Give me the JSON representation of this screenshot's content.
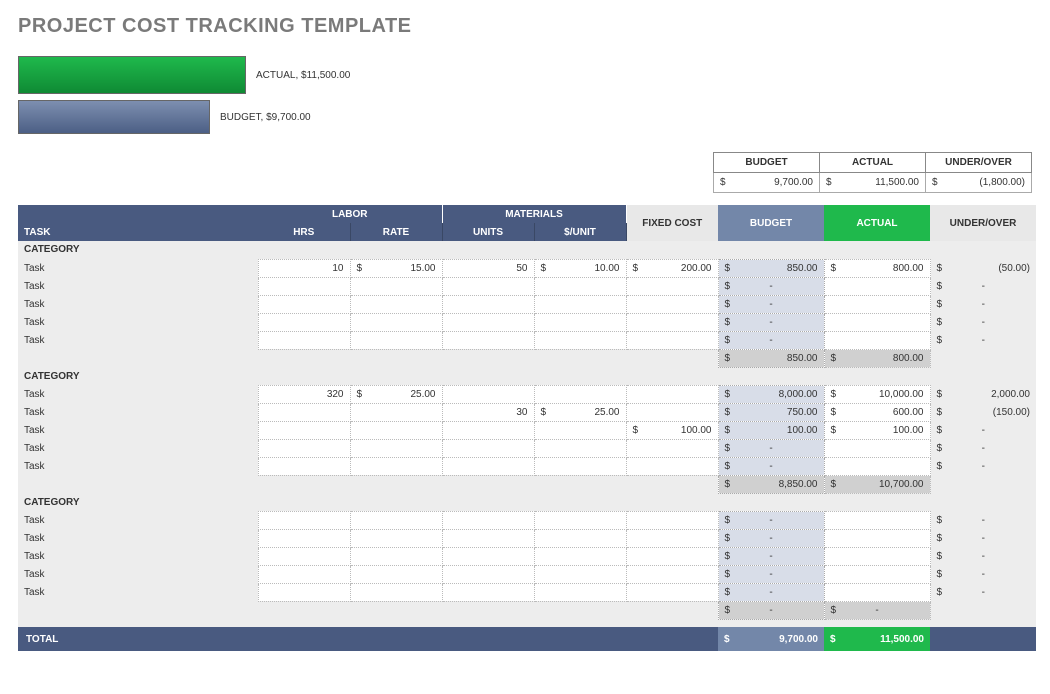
{
  "title": "PROJECT COST TRACKING TEMPLATE",
  "chart_data": {
    "type": "bar",
    "orientation": "horizontal",
    "series": [
      {
        "name": "ACTUAL",
        "value": 11500.0,
        "label": "ACTUAL,  $11,500.00",
        "color": "#1fb94c"
      },
      {
        "name": "BUDGET",
        "value": 9700.0,
        "label": "BUDGET,  $9,700.00",
        "color": "#5a6d93"
      }
    ]
  },
  "summary": {
    "headers": {
      "budget": "BUDGET",
      "actual": "ACTUAL",
      "underover": "UNDER/OVER"
    },
    "budget": "9,700.00",
    "actual": "11,500.00",
    "underover": "(1,800.00)"
  },
  "columns": {
    "task": "TASK",
    "labor": "LABOR",
    "materials": "MATERIALS",
    "fixed": "FIXED COST",
    "budget": "BUDGET",
    "actual": "ACTUAL",
    "underover": "UNDER/OVER",
    "hrs": "HRS",
    "rate": "RATE",
    "units": "UNITS",
    "per_unit": "$/UNIT"
  },
  "categories": [
    {
      "name": "CATEGORY",
      "tasks": [
        {
          "name": "Task",
          "hrs": "10",
          "rate": "15.00",
          "units": "50",
          "per_unit": "10.00",
          "fixed": "200.00",
          "budget": "850.00",
          "actual": "800.00",
          "uo": "(50.00)"
        },
        {
          "name": "Task",
          "hrs": "",
          "rate": "",
          "units": "",
          "per_unit": "",
          "fixed": "",
          "budget": "-",
          "actual": "",
          "uo": "-"
        },
        {
          "name": "Task",
          "hrs": "",
          "rate": "",
          "units": "",
          "per_unit": "",
          "fixed": "",
          "budget": "-",
          "actual": "",
          "uo": "-"
        },
        {
          "name": "Task",
          "hrs": "",
          "rate": "",
          "units": "",
          "per_unit": "",
          "fixed": "",
          "budget": "-",
          "actual": "",
          "uo": "-"
        },
        {
          "name": "Task",
          "hrs": "",
          "rate": "",
          "units": "",
          "per_unit": "",
          "fixed": "",
          "budget": "-",
          "actual": "",
          "uo": "-"
        }
      ],
      "subtotal": {
        "budget": "850.00",
        "actual": "800.00"
      }
    },
    {
      "name": "CATEGORY",
      "tasks": [
        {
          "name": "Task",
          "hrs": "320",
          "rate": "25.00",
          "units": "",
          "per_unit": "",
          "fixed": "",
          "budget": "8,000.00",
          "actual": "10,000.00",
          "uo": "2,000.00"
        },
        {
          "name": "Task",
          "hrs": "",
          "rate": "",
          "units": "30",
          "per_unit": "25.00",
          "fixed": "",
          "budget": "750.00",
          "actual": "600.00",
          "uo": "(150.00)"
        },
        {
          "name": "Task",
          "hrs": "",
          "rate": "",
          "units": "",
          "per_unit": "",
          "fixed": "100.00",
          "budget": "100.00",
          "actual": "100.00",
          "uo": "-"
        },
        {
          "name": "Task",
          "hrs": "",
          "rate": "",
          "units": "",
          "per_unit": "",
          "fixed": "",
          "budget": "-",
          "actual": "",
          "uo": "-"
        },
        {
          "name": "Task",
          "hrs": "",
          "rate": "",
          "units": "",
          "per_unit": "",
          "fixed": "",
          "budget": "-",
          "actual": "",
          "uo": "-"
        }
      ],
      "subtotal": {
        "budget": "8,850.00",
        "actual": "10,700.00"
      }
    },
    {
      "name": "CATEGORY",
      "tasks": [
        {
          "name": "Task",
          "hrs": "",
          "rate": "",
          "units": "",
          "per_unit": "",
          "fixed": "",
          "budget": "-",
          "actual": "",
          "uo": "-"
        },
        {
          "name": "Task",
          "hrs": "",
          "rate": "",
          "units": "",
          "per_unit": "",
          "fixed": "",
          "budget": "-",
          "actual": "",
          "uo": "-"
        },
        {
          "name": "Task",
          "hrs": "",
          "rate": "",
          "units": "",
          "per_unit": "",
          "fixed": "",
          "budget": "-",
          "actual": "",
          "uo": "-"
        },
        {
          "name": "Task",
          "hrs": "",
          "rate": "",
          "units": "",
          "per_unit": "",
          "fixed": "",
          "budget": "-",
          "actual": "",
          "uo": "-"
        },
        {
          "name": "Task",
          "hrs": "",
          "rate": "",
          "units": "",
          "per_unit": "",
          "fixed": "",
          "budget": "-",
          "actual": "",
          "uo": "-"
        }
      ],
      "subtotal": {
        "budget": "-",
        "actual": "-"
      }
    }
  ],
  "total": {
    "label": "TOTAL",
    "budget": "9,700.00",
    "actual": "11,500.00"
  }
}
